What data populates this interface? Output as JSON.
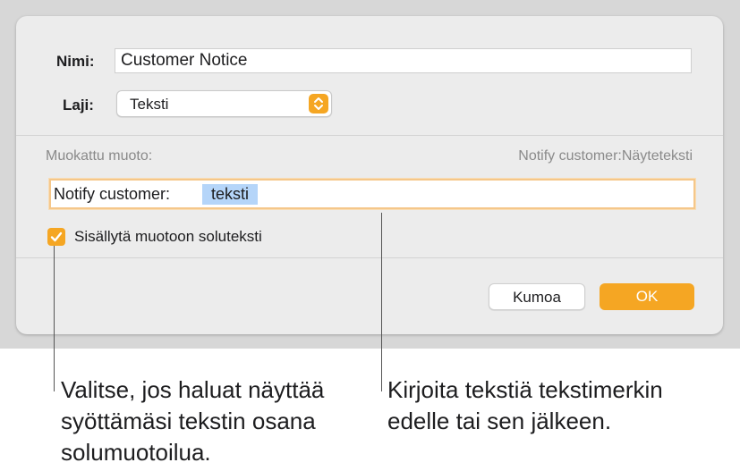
{
  "dialog": {
    "name_label": "Nimi:",
    "name_value": "Customer Notice",
    "type_label": "Laji:",
    "type_value": "Teksti",
    "custom_format_label": "Muokattu muoto:",
    "preview_text": "Notify customer:Näyteteksti",
    "format_prefix": "Notify customer:",
    "format_token": "teksti",
    "include_checkbox": {
      "label": "Sisällytä muotoon soluteksti",
      "checked": true
    },
    "cancel_label": "Kumoa",
    "ok_label": "OK"
  },
  "callouts": {
    "left": "Valitse, jos haluat näyttää\nsyöttämäsi tekstin osana\nsolumuotoilua.",
    "right": "Kirjoita tekstiä tekstimerkin\nedelle tai sen jälkeen."
  },
  "colors": {
    "accent": "#f5a623",
    "token_highlight": "#b5d5f9",
    "focus_ring": "#f5c78a"
  }
}
